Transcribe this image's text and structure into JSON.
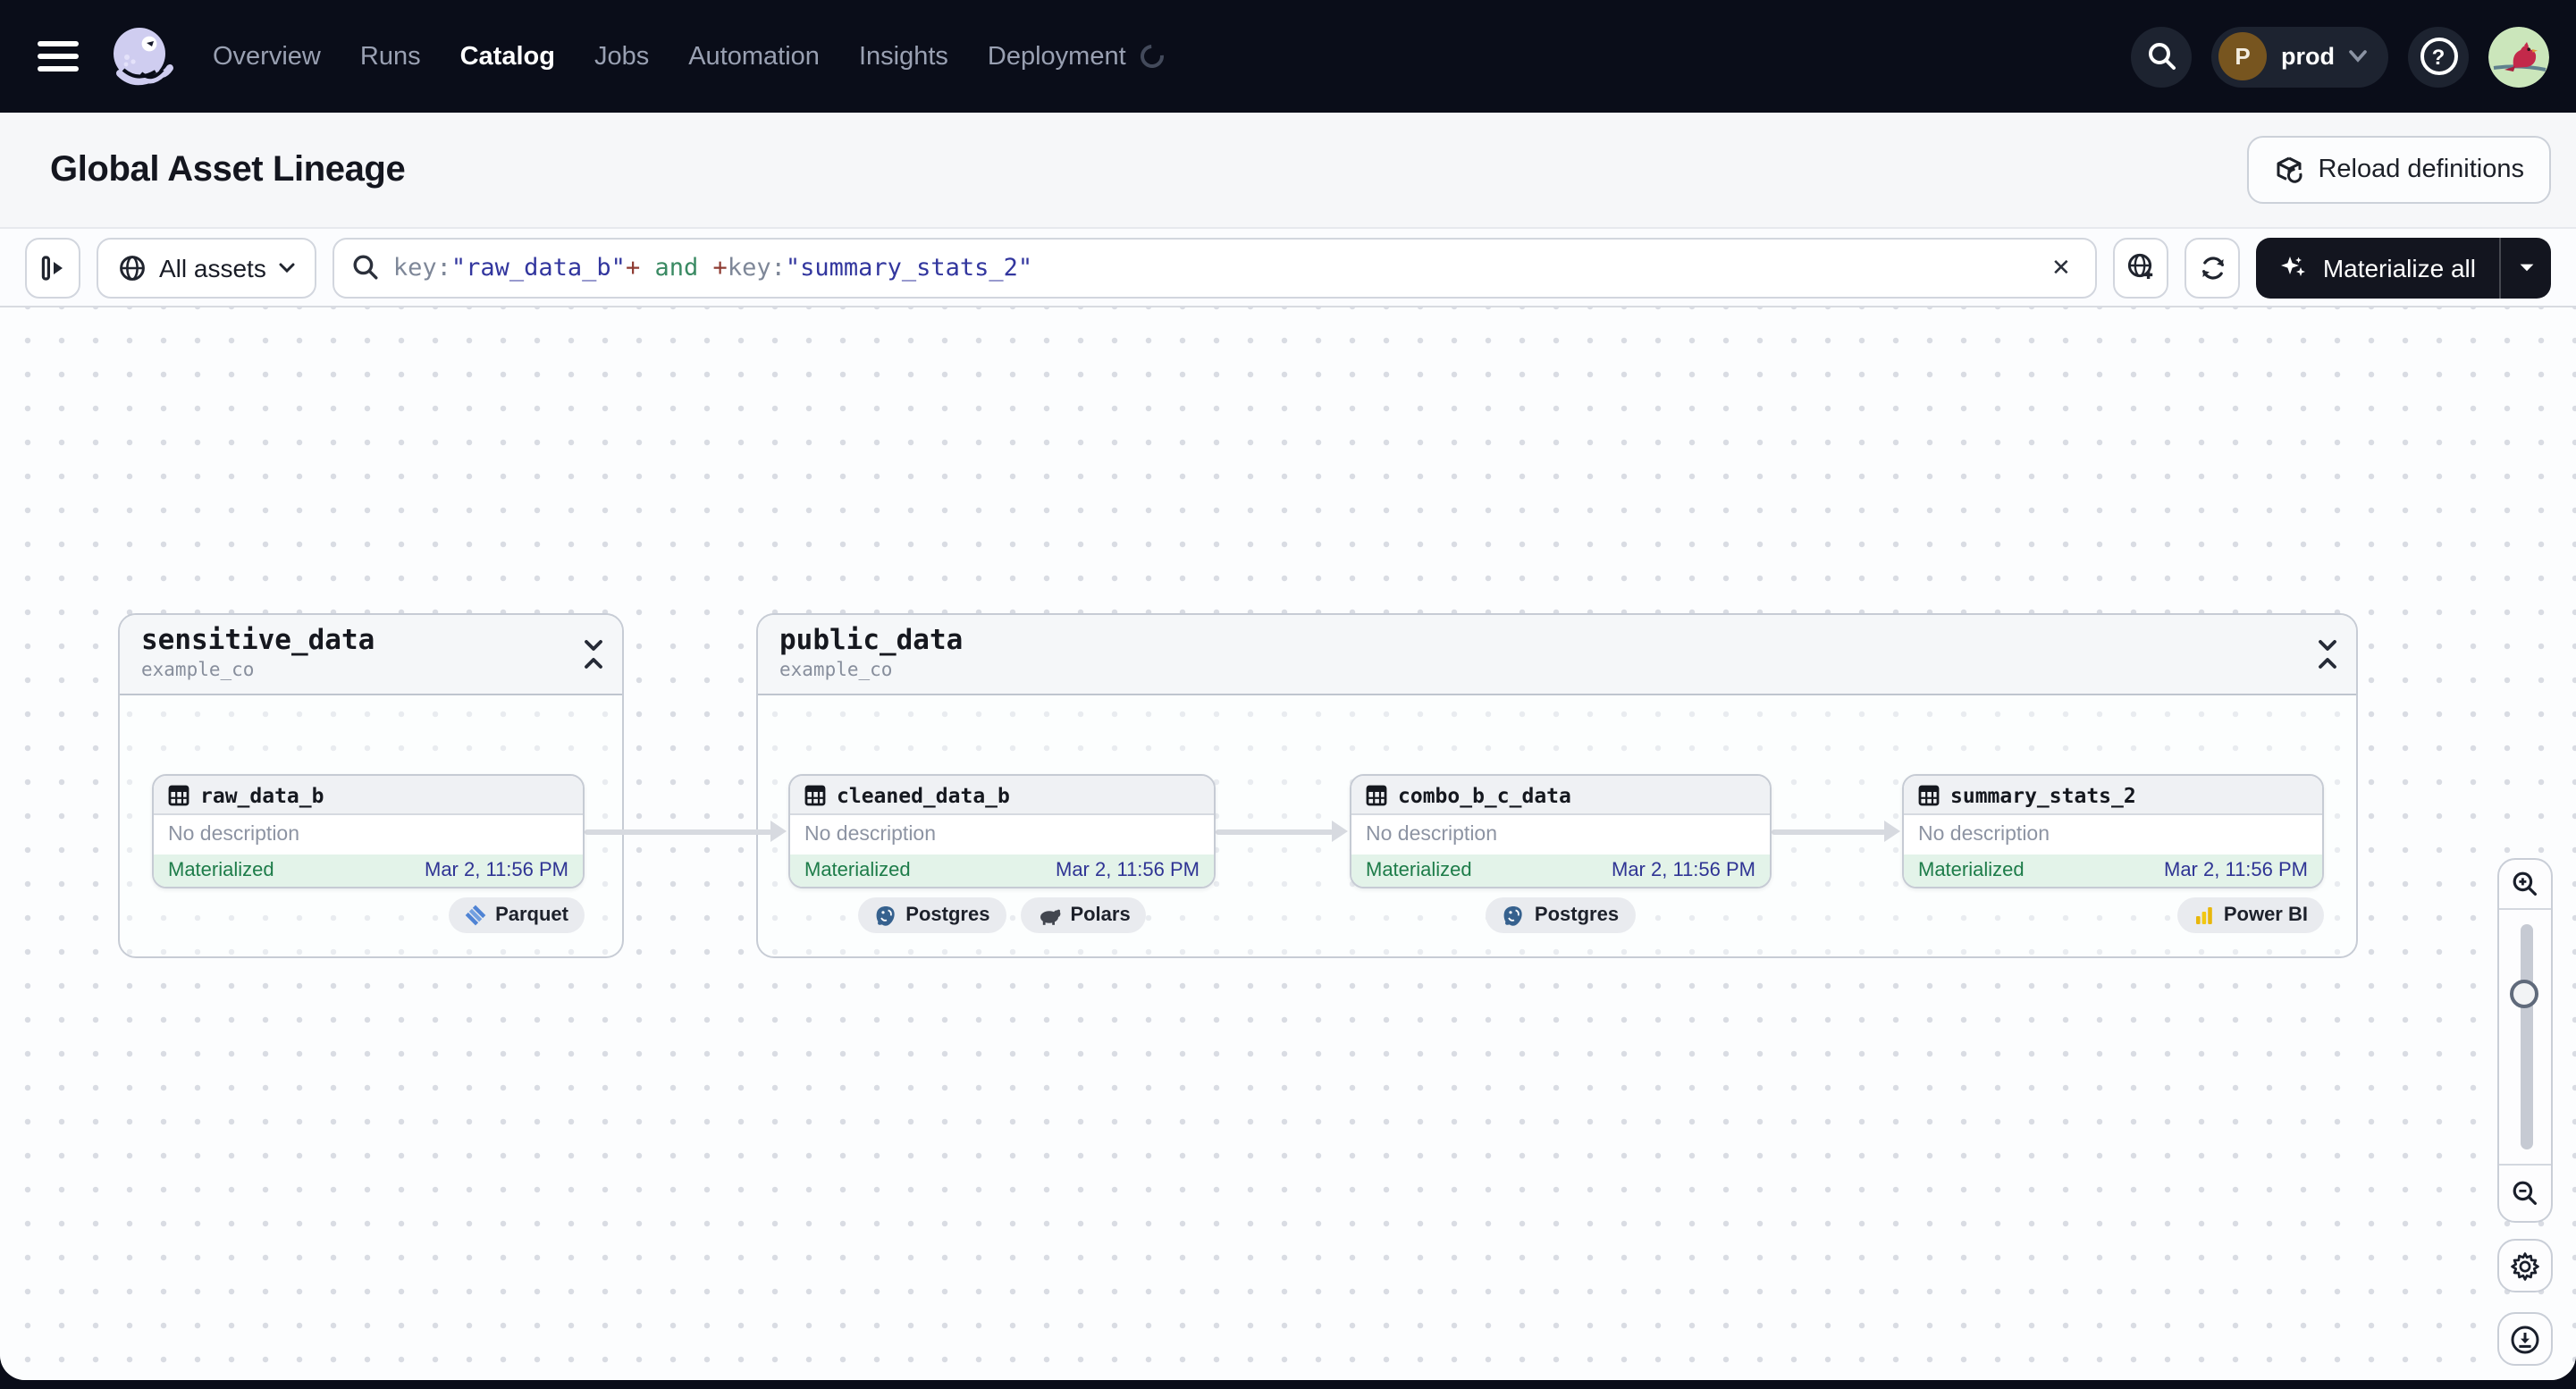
{
  "nav": {
    "items": [
      {
        "label": "Overview",
        "active": false
      },
      {
        "label": "Runs",
        "active": false
      },
      {
        "label": "Catalog",
        "active": true
      },
      {
        "label": "Jobs",
        "active": false
      },
      {
        "label": "Automation",
        "active": false
      },
      {
        "label": "Insights",
        "active": false
      },
      {
        "label": "Deployment",
        "active": false
      }
    ],
    "deployment_switcher": {
      "initial": "P",
      "label": "prod"
    },
    "help_glyph": "?"
  },
  "header": {
    "title": "Global Asset Lineage",
    "reload_button_label": "Reload definitions"
  },
  "toolbar": {
    "scope_label": "All assets",
    "materialize_label": "Materialize all",
    "clear_glyph": "✕",
    "query_segments": [
      {
        "text": "key:",
        "color": "#7e8798"
      },
      {
        "text": "\"raw_data_b\"",
        "color": "#32369e"
      },
      {
        "text": "+",
        "color": "#8e3b32"
      },
      {
        "text": " and ",
        "color": "#3a8a63"
      },
      {
        "text": "+",
        "color": "#8e3b32"
      },
      {
        "text": "key:",
        "color": "#7e8798"
      },
      {
        "text": "\"summary_stats_2\"",
        "color": "#32369e"
      }
    ]
  },
  "graph": {
    "groups": [
      {
        "name": "sensitive_data",
        "repo": "example_co",
        "nodes": [
          {
            "name": "raw_data_b",
            "description": "No description",
            "status": "Materialized",
            "timestamp": "Mar 2, 11:56 PM",
            "badges": [
              {
                "label": "Parquet",
                "icon": "parquet-icon"
              }
            ]
          }
        ]
      },
      {
        "name": "public_data",
        "repo": "example_co",
        "nodes": [
          {
            "name": "cleaned_data_b",
            "description": "No description",
            "status": "Materialized",
            "timestamp": "Mar 2, 11:56 PM",
            "badges": [
              {
                "label": "Postgres",
                "icon": "postgres-icon"
              },
              {
                "label": "Polars",
                "icon": "polars-icon"
              }
            ]
          },
          {
            "name": "combo_b_c_data",
            "description": "No description",
            "status": "Materialized",
            "timestamp": "Mar 2, 11:56 PM",
            "badges": [
              {
                "label": "Postgres",
                "icon": "postgres-icon"
              }
            ]
          },
          {
            "name": "summary_stats_2",
            "description": "No description",
            "status": "Materialized",
            "timestamp": "Mar 2, 11:56 PM",
            "badges": [
              {
                "label": "Power BI",
                "icon": "powerbi-icon"
              }
            ]
          }
        ]
      }
    ]
  },
  "colors": {
    "nav_background": "#0a0d19",
    "accent_status_green": "#1d7c49",
    "materialized_footer_bg": "#e3f3e9",
    "timestamp_indigo": "#2f3494",
    "query_string_indigo": "#32369e",
    "query_operator_red": "#8e3b32",
    "query_keyword_green": "#3a8a63",
    "materialize_button_bg": "#13151f"
  }
}
